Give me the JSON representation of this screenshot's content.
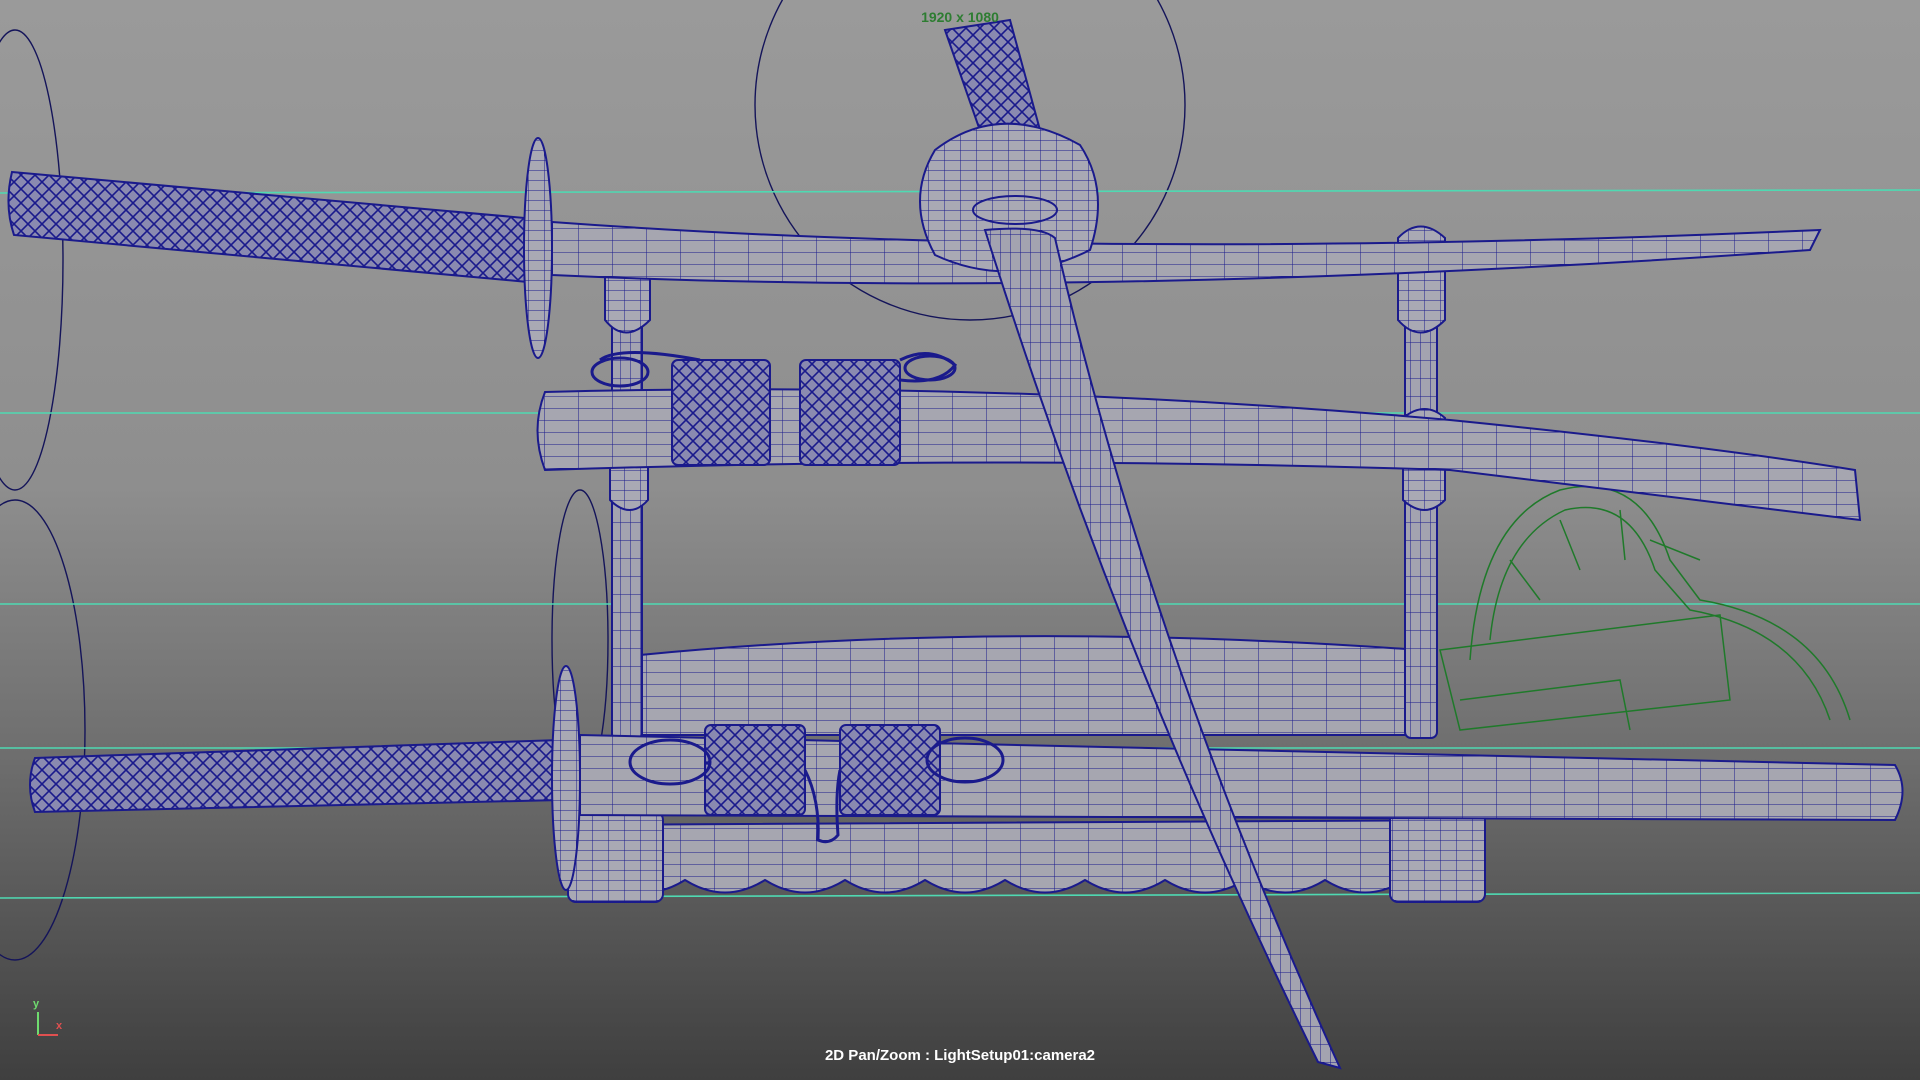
{
  "viewport": {
    "resolution_gate_label": "1920 x 1080",
    "camera_label": "2D Pan/Zoom : LightSetup01:camera2",
    "axis_y": "y",
    "axis_x": "x"
  },
  "colors": {
    "wireframe": "#1a1a8c",
    "guide_line": "#4fd9b2",
    "selected_object": "#1f7a2a",
    "light_helper": "#14145a"
  },
  "objects": [
    "katana-top",
    "wakizashi-saya-middle",
    "katana-bottom-saya",
    "tanto-blade-diagonal",
    "sword-stand",
    "stand-base",
    "green-selected-object"
  ]
}
